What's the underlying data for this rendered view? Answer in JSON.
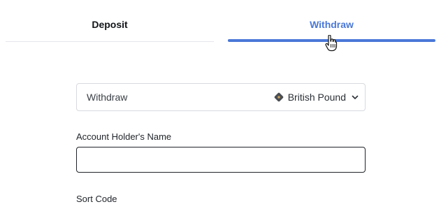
{
  "tabs": {
    "deposit_label": "Deposit",
    "withdraw_label": "Withdraw",
    "active": "Withdraw"
  },
  "select": {
    "mode_label": "Withdraw",
    "currency_label": "British Pound",
    "currency_icon": "diamond-currency-icon",
    "chevron_icon": "chevron-down-icon"
  },
  "form": {
    "account_holder_label": "Account Holder's Name",
    "account_holder_value": "",
    "sort_code_label": "Sort Code"
  },
  "colors": {
    "accent": "#4a78d8",
    "divider": "#e3e6ea",
    "border": "#d6d9de",
    "text": "#1f2328"
  }
}
